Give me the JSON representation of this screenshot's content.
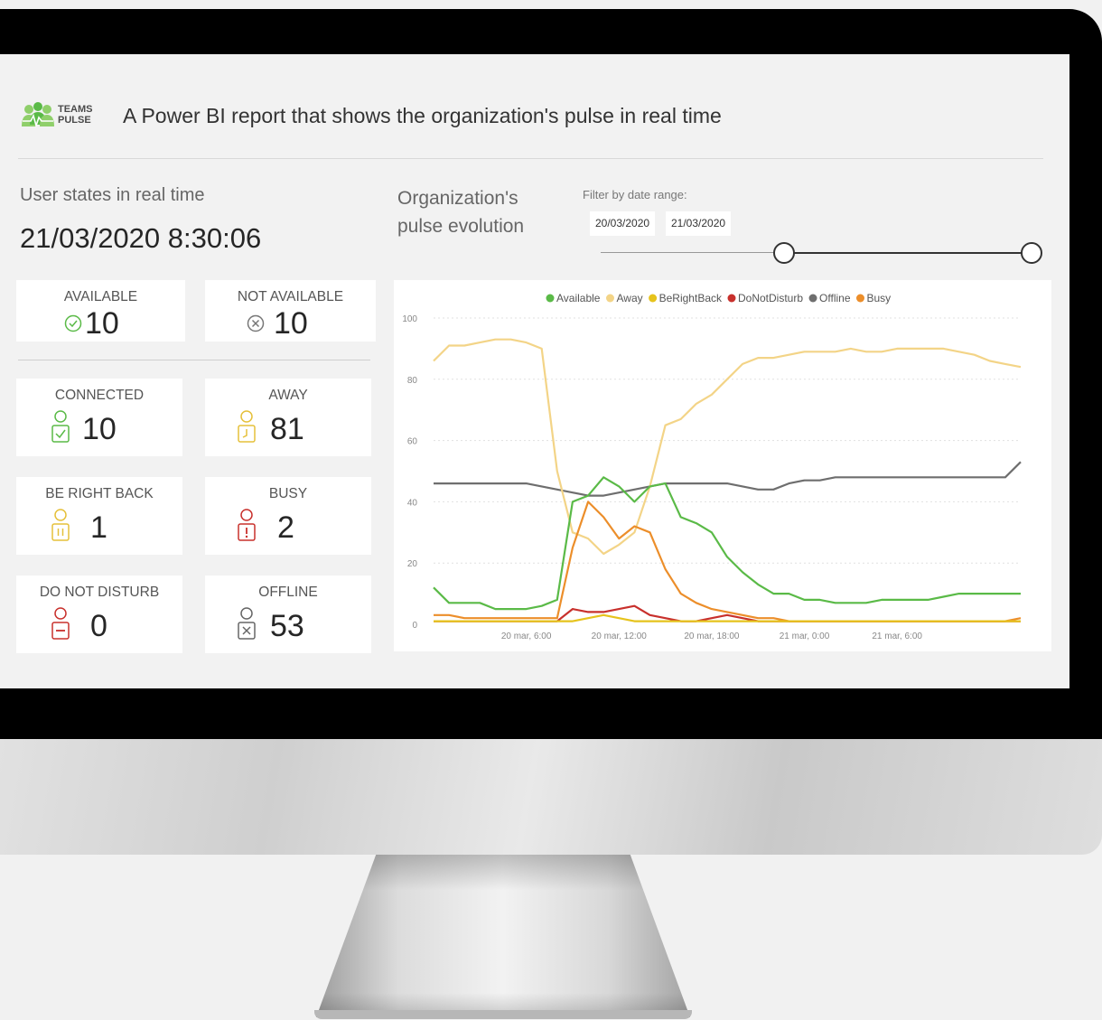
{
  "header": {
    "logo_line1": "TEAMS",
    "logo_line2": "PULSE",
    "title": "A Power BI report that shows the organization's pulse in real time"
  },
  "left_panel": {
    "section_label": "User states in real time",
    "timestamp": "21/03/2020 8:30:06",
    "cards": {
      "available": {
        "label": "AVAILABLE",
        "value": "10",
        "icon": "check-circle-icon",
        "color": "#5aba47"
      },
      "not_available": {
        "label": "NOT AVAILABLE",
        "value": "10",
        "icon": "x-circle-icon",
        "color": "#777777"
      },
      "connected": {
        "label": "CONNECTED",
        "value": "10",
        "icon": "person-check-icon",
        "color": "#5aba47"
      },
      "away": {
        "label": "AWAY",
        "value": "81",
        "icon": "person-clock-icon",
        "color": "#e5c03a"
      },
      "be_right_back": {
        "label": "BE RIGHT BACK",
        "value": "1",
        "icon": "person-pause-icon",
        "color": "#e5c03a"
      },
      "busy": {
        "label": "BUSY",
        "value": "2",
        "icon": "person-exclamation-icon",
        "color": "#c8302c"
      },
      "do_not_disturb": {
        "label": "DO NOT DISTURB",
        "value": "0",
        "icon": "person-minus-icon",
        "color": "#c8302c"
      },
      "offline": {
        "label": "OFFLINE",
        "value": "53",
        "icon": "person-x-icon",
        "color": "#666666"
      }
    }
  },
  "right_panel": {
    "title": "Organization's pulse evolution",
    "filter_label": "Filter by date range:",
    "date_from": "20/03/2020",
    "date_to": "21/03/2020"
  },
  "chart_data": {
    "type": "line",
    "title": "",
    "xlabel": "",
    "ylabel": "",
    "ylim": [
      0,
      100
    ],
    "yticks": [
      0,
      20,
      40,
      60,
      80,
      100
    ],
    "xlim_hours": [
      0,
      38
    ],
    "xticks": [
      {
        "label": "20 mar, 6:00",
        "hour": 6
      },
      {
        "label": "20 mar, 12:00",
        "hour": 12
      },
      {
        "label": "20 mar, 18:00",
        "hour": 18
      },
      {
        "label": "21 mar, 0:00",
        "hour": 24
      },
      {
        "label": "21 mar, 6:00",
        "hour": 30
      }
    ],
    "grid": "dotted-horizontal",
    "legend": "top",
    "x_hours": [
      0,
      1,
      2,
      3,
      4,
      5,
      6,
      7,
      8,
      9,
      10,
      11,
      12,
      13,
      14,
      15,
      16,
      17,
      18,
      19,
      20,
      21,
      22,
      23,
      24,
      25,
      26,
      27,
      28,
      29,
      30,
      31,
      32,
      33,
      34,
      35,
      36,
      37,
      38
    ],
    "series": [
      {
        "name": "Available",
        "color": "#5aba47",
        "values": [
          12,
          7,
          7,
          7,
          5,
          5,
          5,
          6,
          8,
          40,
          42,
          48,
          45,
          40,
          45,
          46,
          35,
          33,
          30,
          22,
          17,
          13,
          10,
          10,
          8,
          8,
          7,
          7,
          7,
          8,
          8,
          8,
          8,
          9,
          10,
          10,
          10,
          10,
          10
        ]
      },
      {
        "name": "Away",
        "color": "#f3d487",
        "values": [
          86,
          91,
          91,
          92,
          93,
          93,
          92,
          90,
          50,
          30,
          28,
          23,
          26,
          30,
          45,
          65,
          67,
          72,
          75,
          80,
          85,
          87,
          87,
          88,
          89,
          89,
          89,
          90,
          89,
          89,
          90,
          90,
          90,
          90,
          89,
          88,
          86,
          85,
          84
        ]
      },
      {
        "name": "BeRightBack",
        "color": "#e6c31c",
        "values": [
          1,
          1,
          1,
          1,
          1,
          1,
          1,
          1,
          1,
          1,
          2,
          3,
          2,
          1,
          1,
          1,
          1,
          1,
          1,
          1,
          1,
          1,
          1,
          1,
          1,
          1,
          1,
          1,
          1,
          1,
          1,
          1,
          1,
          1,
          1,
          1,
          1,
          1,
          1
        ]
      },
      {
        "name": "DoNotDisturb",
        "color": "#c8302c",
        "values": [
          1,
          1,
          1,
          1,
          1,
          1,
          1,
          1,
          1,
          5,
          4,
          4,
          5,
          6,
          3,
          2,
          1,
          1,
          2,
          3,
          2,
          1,
          1,
          1,
          1,
          1,
          1,
          1,
          1,
          1,
          1,
          1,
          1,
          1,
          1,
          1,
          1,
          1,
          1
        ]
      },
      {
        "name": "Offline",
        "color": "#6e6e6e",
        "values": [
          46,
          46,
          46,
          46,
          46,
          46,
          46,
          45,
          44,
          43,
          42,
          42,
          43,
          44,
          45,
          46,
          46,
          46,
          46,
          46,
          45,
          44,
          44,
          46,
          47,
          47,
          48,
          48,
          48,
          48,
          48,
          48,
          48,
          48,
          48,
          48,
          48,
          48,
          53
        ]
      },
      {
        "name": "Busy",
        "color": "#ec8e2a",
        "values": [
          3,
          3,
          2,
          2,
          2,
          2,
          2,
          2,
          2,
          25,
          40,
          35,
          28,
          32,
          30,
          18,
          10,
          7,
          5,
          4,
          3,
          2,
          2,
          1,
          1,
          1,
          1,
          1,
          1,
          1,
          1,
          1,
          1,
          1,
          1,
          1,
          1,
          1,
          2
        ]
      }
    ]
  }
}
